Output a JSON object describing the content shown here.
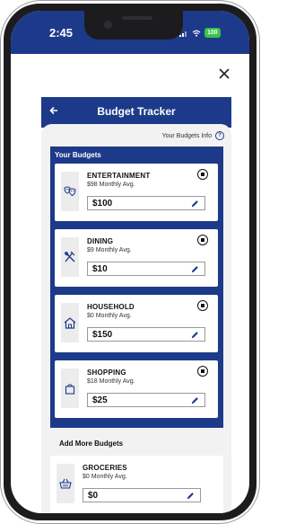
{
  "status_bar": {
    "time": "2:45",
    "battery": "100"
  },
  "header": {
    "title": "Budget Tracker",
    "back_icon": "back-arrow-icon"
  },
  "info_link": "Your Budgets Info",
  "your_budgets": {
    "title": "Your Budgets",
    "items": [
      {
        "name": "ENTERTAINMENT",
        "avg": "$98 Monthly Avg.",
        "amount": "$100",
        "icon": "theater-masks-icon"
      },
      {
        "name": "DINING",
        "avg": "$9 Monthly Avg.",
        "amount": "$10",
        "icon": "utensils-icon"
      },
      {
        "name": "HOUSEHOLD",
        "avg": "$0 Monthly Avg.",
        "amount": "$150",
        "icon": "house-icon"
      },
      {
        "name": "SHOPPING",
        "avg": "$18 Monthly Avg.",
        "amount": "$25",
        "icon": "shopping-bag-icon"
      }
    ]
  },
  "add_more": {
    "title": "Add More Budgets",
    "items": [
      {
        "name": "GROCERIES",
        "avg": "$0 Monthly Avg.",
        "amount": "$0",
        "icon": "basket-icon"
      }
    ]
  },
  "colors": {
    "primary": "#1d3a8a",
    "background": "#f2f2f2",
    "battery": "#37c24a"
  }
}
